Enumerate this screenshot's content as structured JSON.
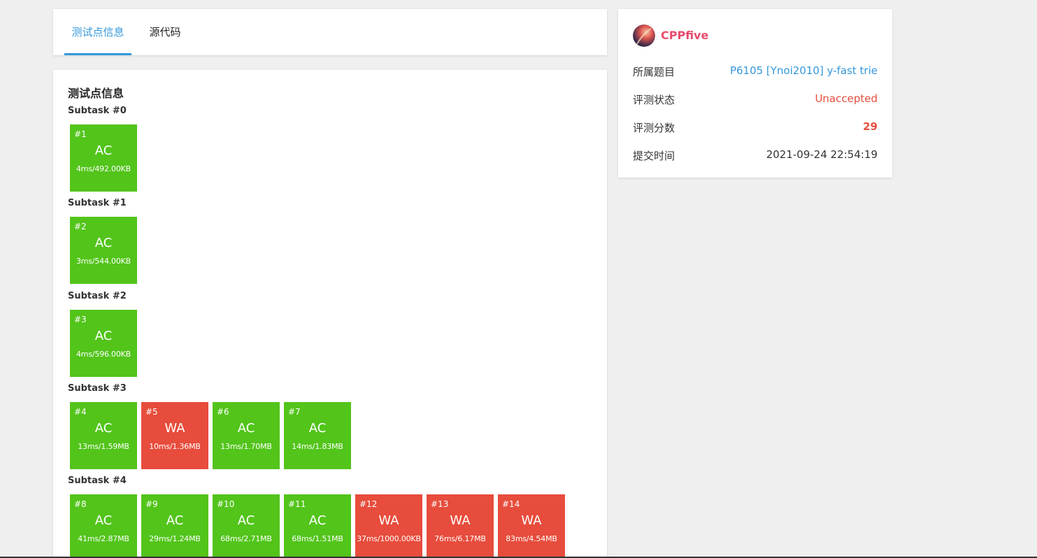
{
  "tabs": [
    {
      "label": "测试点信息",
      "active": true
    },
    {
      "label": "源代码",
      "active": false
    }
  ],
  "main": {
    "title": "测试点信息",
    "subtasks": [
      {
        "title": "Subtask #0",
        "cases": [
          {
            "num": "#1",
            "status": "AC",
            "meta": "4ms/492.00KB"
          }
        ]
      },
      {
        "title": "Subtask #1",
        "cases": [
          {
            "num": "#2",
            "status": "AC",
            "meta": "3ms/544.00KB"
          }
        ]
      },
      {
        "title": "Subtask #2",
        "cases": [
          {
            "num": "#3",
            "status": "AC",
            "meta": "4ms/596.00KB"
          }
        ]
      },
      {
        "title": "Subtask #3",
        "cases": [
          {
            "num": "#4",
            "status": "AC",
            "meta": "13ms/1.59MB"
          },
          {
            "num": "#5",
            "status": "WA",
            "meta": "10ms/1.36MB"
          },
          {
            "num": "#6",
            "status": "AC",
            "meta": "13ms/1.70MB"
          },
          {
            "num": "#7",
            "status": "AC",
            "meta": "14ms/1.83MB"
          }
        ]
      },
      {
        "title": "Subtask #4",
        "cases": [
          {
            "num": "#8",
            "status": "AC",
            "meta": "41ms/2.87MB"
          },
          {
            "num": "#9",
            "status": "AC",
            "meta": "29ms/1.24MB"
          },
          {
            "num": "#10",
            "status": "AC",
            "meta": "68ms/2.71MB"
          },
          {
            "num": "#11",
            "status": "AC",
            "meta": "68ms/1.51MB"
          },
          {
            "num": "#12",
            "status": "WA",
            "meta": "37ms/1000.00KB"
          },
          {
            "num": "#13",
            "status": "WA",
            "meta": "76ms/6.17MB"
          },
          {
            "num": "#14",
            "status": "WA",
            "meta": "83ms/4.54MB"
          }
        ]
      }
    ]
  },
  "sidebar": {
    "username": "CPPfive",
    "rows": {
      "problem": {
        "label": "所属题目",
        "value": "P6105 [Ynoi2010] y-fast trie"
      },
      "status": {
        "label": "评测状态",
        "value": "Unaccepted"
      },
      "score": {
        "label": "评测分数",
        "value": "29"
      },
      "time": {
        "label": "提交时间",
        "value": "2021-09-24 22:54:19"
      }
    }
  },
  "colors": {
    "accent": "#3498db",
    "ac": "#52c41a",
    "wa": "#e74c3c",
    "username": "#e74c6c"
  }
}
